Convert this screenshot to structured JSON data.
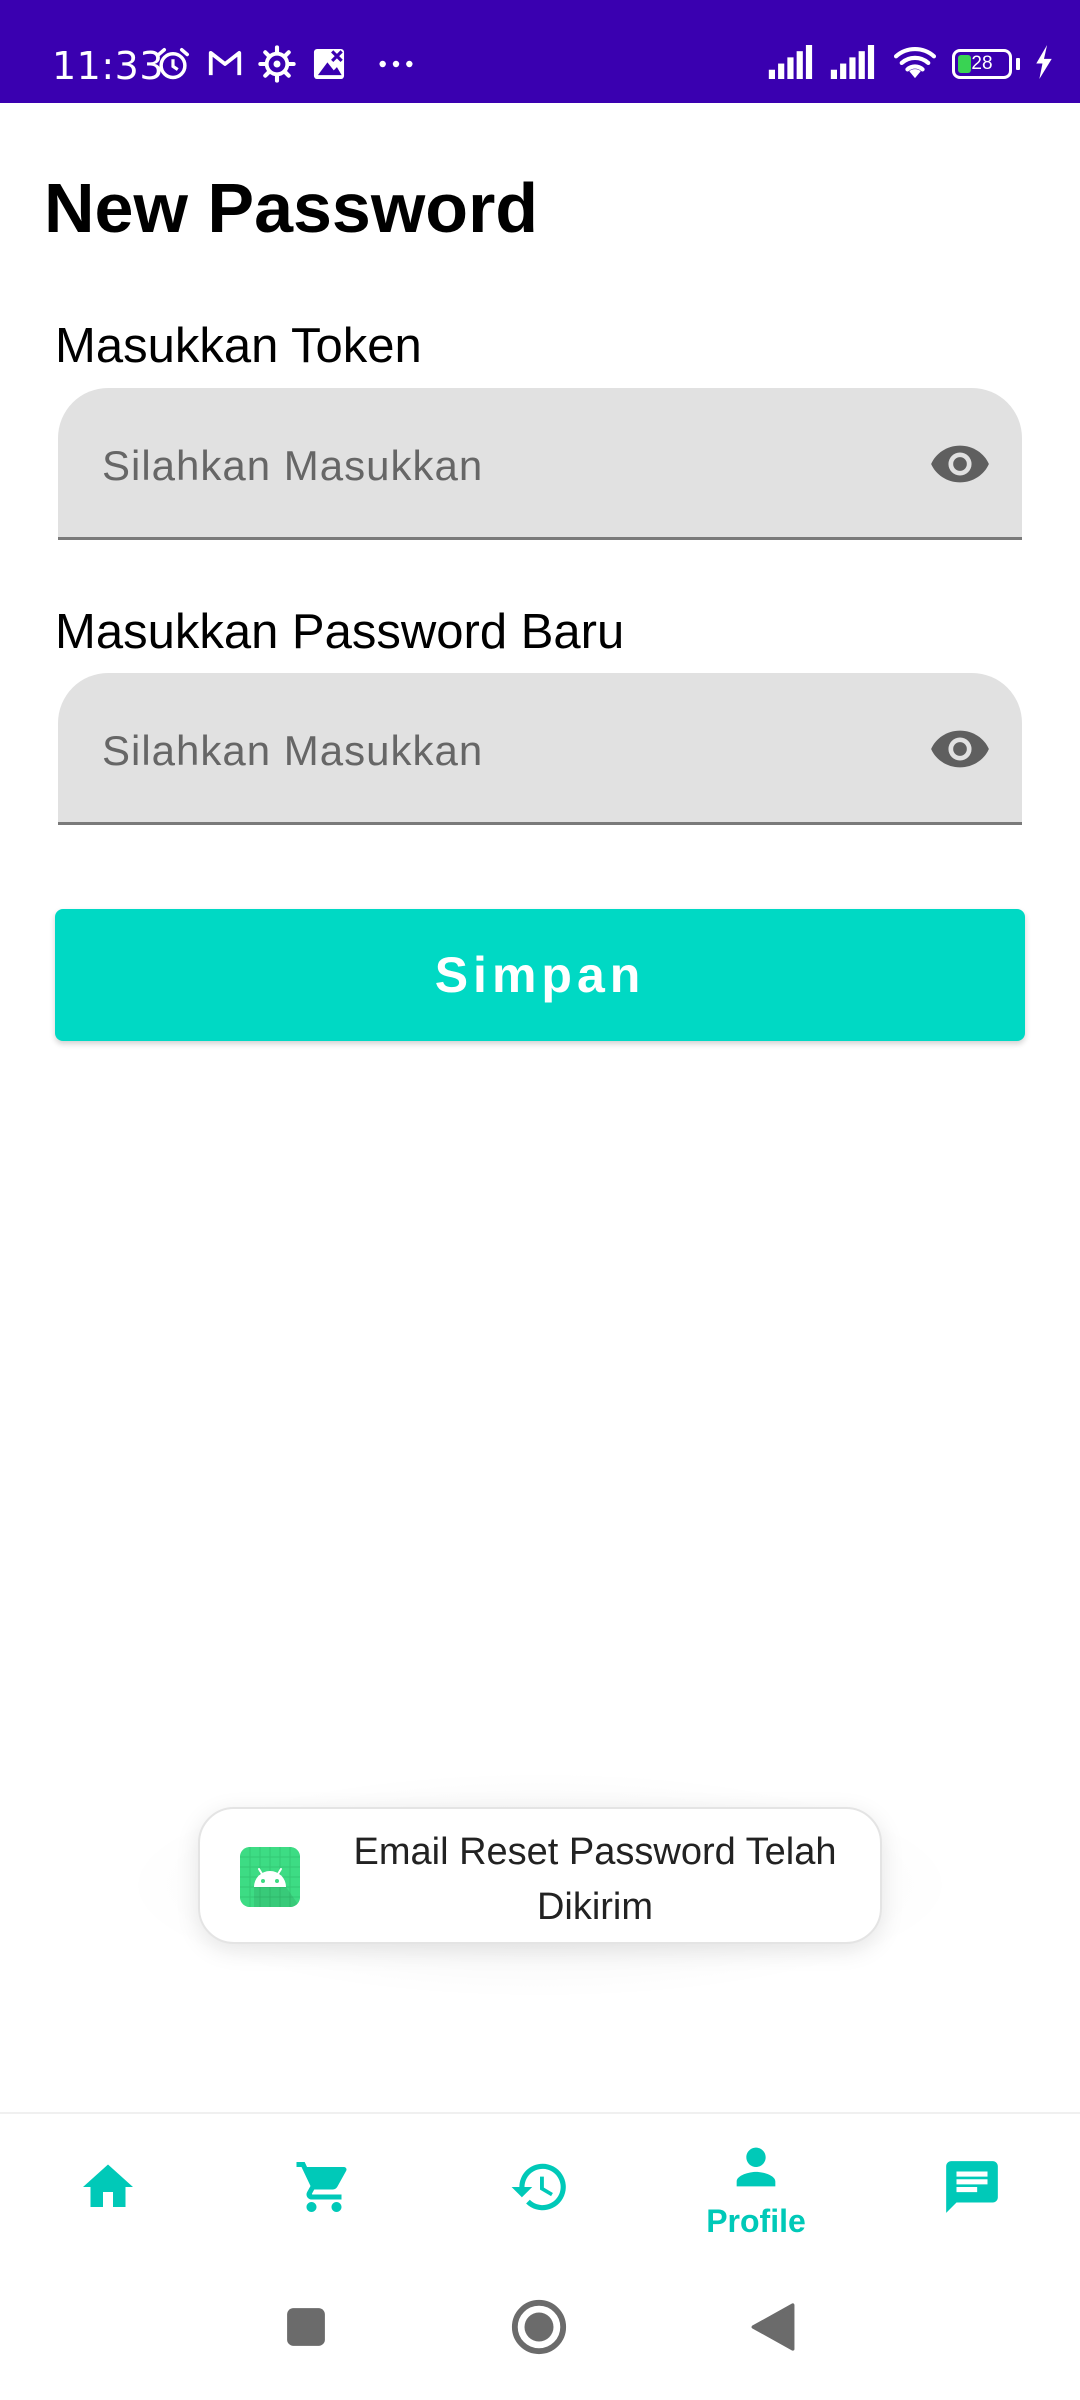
{
  "status_bar": {
    "time": "11:33",
    "battery_level": "28",
    "battery_fraction": 0.28,
    "background_color": "#3a00b0",
    "left_icons": [
      "alarm-icon",
      "gmail-icon",
      "settings-icon",
      "image-icon",
      "more-icon"
    ],
    "right_icons": [
      "signal-icon",
      "signal-icon",
      "wifi-icon",
      "battery-icon",
      "charging-icon"
    ]
  },
  "page": {
    "title": "New Password"
  },
  "form": {
    "token": {
      "label": "Masukkan Token",
      "placeholder": "Silahkan Masukkan",
      "value": "",
      "toggle_icon": "eye-icon"
    },
    "new_password": {
      "label": "Masukkan Password Baru",
      "placeholder": "Silahkan Masukkan",
      "value": "",
      "toggle_icon": "eye-icon"
    },
    "save_label": "Simpan",
    "accent_color": "#00d9c4"
  },
  "toast": {
    "message": "Email Reset Password Telah Dikirim",
    "icon": "android-app-icon"
  },
  "bottom_nav": {
    "items": [
      {
        "icon": "home-icon",
        "label": "",
        "active": false
      },
      {
        "icon": "cart-icon",
        "label": "",
        "active": false
      },
      {
        "icon": "history-icon",
        "label": "",
        "active": false
      },
      {
        "icon": "profile-icon",
        "label": "Profile",
        "active": true
      },
      {
        "icon": "chat-icon",
        "label": "",
        "active": false
      }
    ],
    "active_color": "#00c9b8"
  },
  "system_nav": {
    "buttons": [
      "recents-icon",
      "home-circle-icon",
      "back-icon"
    ]
  }
}
